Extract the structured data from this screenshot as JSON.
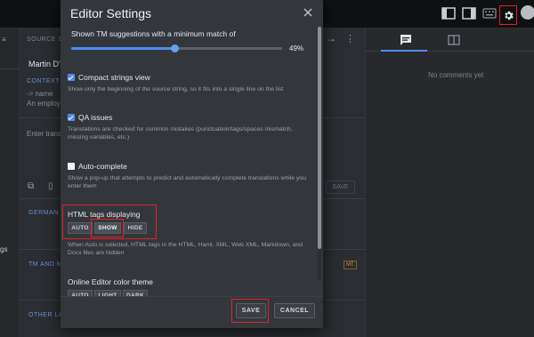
{
  "topbar": {
    "icons": [
      "layout-left-icon",
      "layout-right-icon",
      "keyboard-icon",
      "gear-icon"
    ]
  },
  "background": {
    "source_label": "SOURCE ST",
    "author": "Martin D'V",
    "context_label": "CONTEXT",
    "context_line1": "-> name",
    "context_line2": "An employ",
    "enter_translation": "Enter trans",
    "german_label": "GERMAN T",
    "tm_label": "TM AND M",
    "other_label": "OTHER LAN",
    "left_ags": "gs",
    "save_label": "SAVE",
    "mt_badge": "MT",
    "no_comments": "No comments yet"
  },
  "modal": {
    "title": "Editor Settings",
    "tm_label": "Shown TM suggestions with a minimum match of",
    "tm_value_text": "49%",
    "tm_value": 49,
    "compact": {
      "label": "Compact strings view",
      "desc": "Show only the beginning of the source string, so it fits into a single line on the list",
      "checked": true
    },
    "qa": {
      "label": "QA issues",
      "desc": "Translations are checked for common mistakes (punctuation/tags/spaces mismatch, missing variables, etc.)",
      "checked": true
    },
    "autocomplete": {
      "label": "Auto-complete",
      "desc": "Show a pop-up that attempts to predict and automatically complete translations while you enter them",
      "checked": false
    },
    "html_tags": {
      "label": "HTML tags displaying",
      "options": [
        "AUTO",
        "SHOW",
        "HIDE"
      ],
      "selected": "SHOW",
      "desc": "When Auto is selected, HTML tags in the HTML, Haml, XML, Web XML, Markdown, and Docx files are hidden"
    },
    "color_theme": {
      "label": "Online Editor color theme",
      "options": [
        "AUTO",
        "LIGHT",
        "DARK"
      ]
    },
    "save": "SAVE",
    "cancel": "CANCEL"
  },
  "colors": {
    "accent": "#4f8de6",
    "highlight": "#e0202a",
    "modal_bg": "#33373c"
  }
}
